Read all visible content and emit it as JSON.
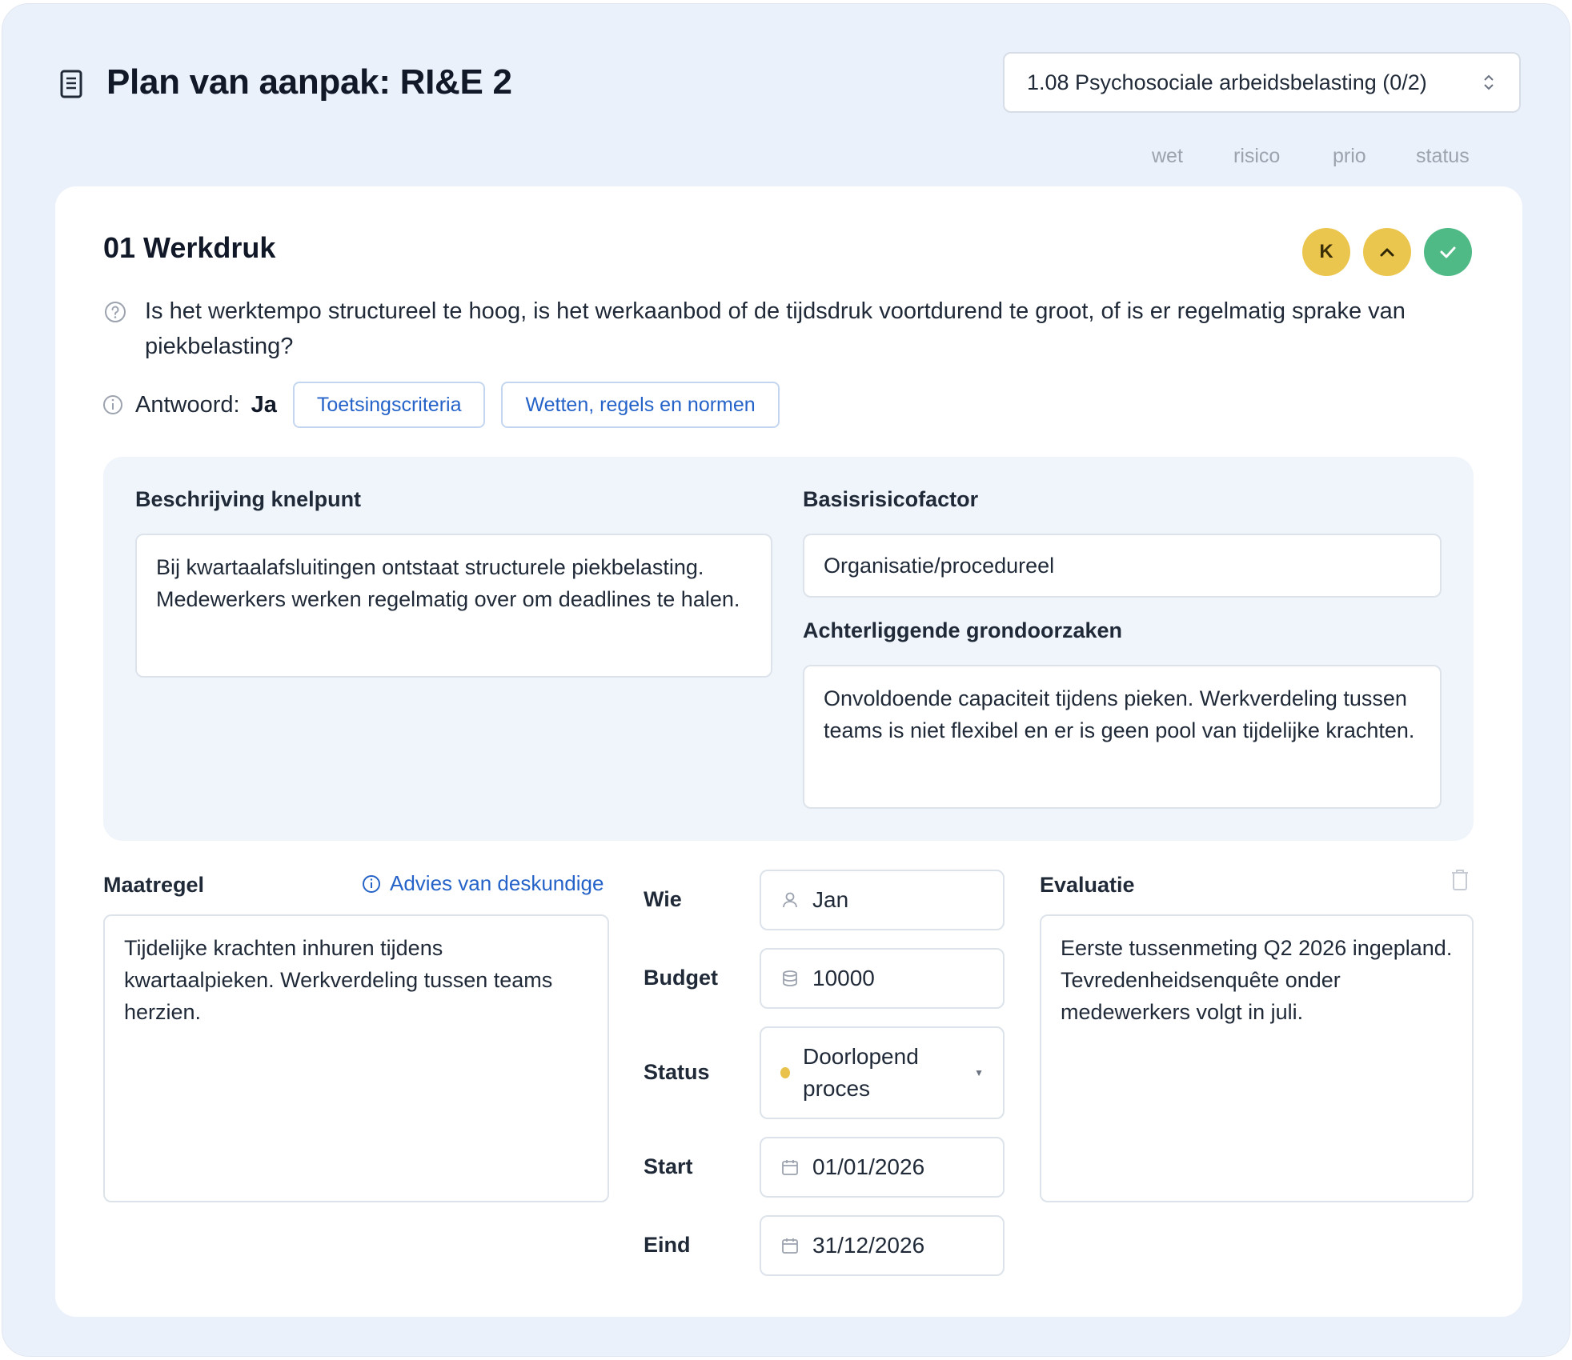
{
  "header": {
    "title": "Plan van aanpak: RI&E 2",
    "section_select": "1.08 Psychosociale arbeidsbelasting (0/2)"
  },
  "columns": [
    "wet",
    "risico",
    "prio",
    "status"
  ],
  "item": {
    "title": "01 Werkdruk",
    "badges": {
      "wet": "K",
      "risico_icon": "chevron-up-icon",
      "status_icon": "check-icon"
    },
    "question": "Is het werktempo structureel te hoog, is het werkaanbod of de tijdsdruk voortdurend te groot, of is er regelmatig sprake van piekbelasting?",
    "answer_label": "Antwoord:",
    "answer_value": "Ja",
    "buttons": {
      "criteria": "Toetsingscriteria",
      "laws": "Wetten, regels en normen"
    }
  },
  "knelpunt": {
    "description_label": "Beschrijving knelpunt",
    "description_value": "Bij kwartaalafsluitingen ontstaat structurele piekbelasting. Medewerkers werken regelmatig over om deadlines te halen.",
    "risk_factor_label": "Basisrisicofactor",
    "risk_factor_value": "Organisatie/procedureel",
    "root_causes_label": "Achterliggende grondoorzaken",
    "root_causes_value": "Onvoldoende capaciteit tijdens pieken. Werkverdeling tussen teams is niet flexibel en er is geen pool van tijdelijke krachten."
  },
  "maatregel": {
    "label": "Maatregel",
    "advice_link": "Advies van deskundige",
    "value": "Tijdelijke krachten inhuren tijdens kwartaalpieken. Werkverdeling tussen teams herzien."
  },
  "details": {
    "who_label": "Wie",
    "who_value": "Jan",
    "budget_label": "Budget",
    "budget_value": "10000",
    "status_label": "Status",
    "status_value": "Doorlopend proces",
    "status_color": "#e8c24a",
    "start_label": "Start",
    "start_value": "01/01/2026",
    "end_label": "Eind",
    "end_value": "31/12/2026"
  },
  "evaluatie": {
    "label": "Evaluatie",
    "value": "Eerste tussenmeting Q2 2026 ingepland. Tevredenheidsenquête onder medewerkers volgt in juli."
  },
  "colors": {
    "background": "#ebf1fa",
    "accent_link": "#2563c9",
    "badge_yellow": "#ebc64e",
    "badge_green": "#4fba86"
  }
}
